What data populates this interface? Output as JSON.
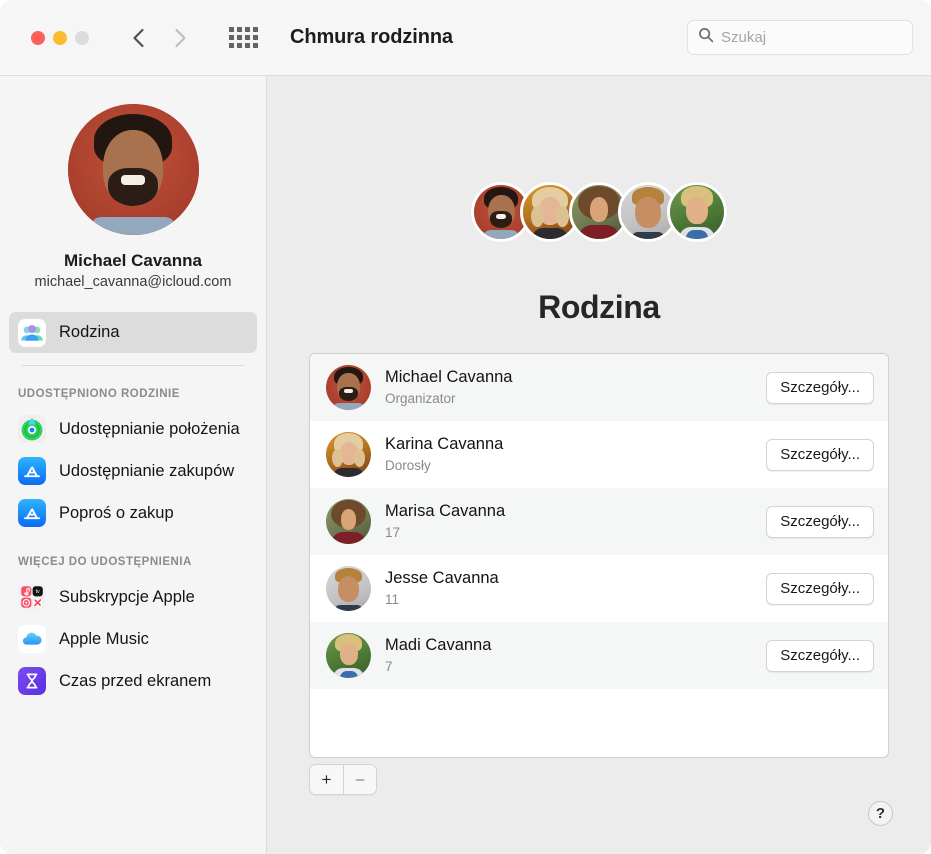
{
  "window": {
    "title": "Chmura rodzinna",
    "traffic_lights": [
      "close",
      "minimize",
      "zoom"
    ],
    "back_label": "Wstecz",
    "forward_label": "Dalej",
    "grid_label": "Pokaż wszystko"
  },
  "search": {
    "placeholder": "Szukaj",
    "value": "",
    "icon": "search-icon"
  },
  "sidebar": {
    "account": {
      "name": "Michael Cavanna",
      "email": "michael_cavanna@icloud.com",
      "avatar": "account-photo"
    },
    "primary": [
      {
        "label": "Rodzina",
        "icon": "family-group-icon",
        "selected": true
      }
    ],
    "sections": [
      {
        "heading": "UDOSTĘPNIONO RODZINIE",
        "items": [
          {
            "label": "Udostępnianie położenia",
            "icon": "find-my-icon"
          },
          {
            "label": "Udostępnianie zakupów",
            "icon": "app-store-icon"
          },
          {
            "label": "Poproś o zakup",
            "icon": "app-store-icon"
          }
        ]
      },
      {
        "heading": "WIĘCEJ DO UDOSTĘPNIENIA",
        "items": [
          {
            "label": "Subskrypcje Apple",
            "icon": "apple-services-icon"
          },
          {
            "label": "Apple Music",
            "icon": "icloud-icon"
          },
          {
            "label": "Czas przed ekranem",
            "icon": "screen-time-icon"
          }
        ]
      }
    ]
  },
  "main": {
    "title": "Rodzina",
    "avatar_stack": [
      "michael-avatar",
      "karina-avatar",
      "marisa-avatar",
      "jesse-avatar",
      "madi-avatar"
    ],
    "members": [
      {
        "name": "Michael Cavanna",
        "role": "Organizator",
        "button": "Szczegóły...",
        "avatar": "michael-avatar"
      },
      {
        "name": "Karina Cavanna",
        "role": "Dorosły",
        "button": "Szczegóły...",
        "avatar": "karina-avatar"
      },
      {
        "name": "Marisa Cavanna",
        "role": "17",
        "button": "Szczegóły...",
        "avatar": "marisa-avatar"
      },
      {
        "name": "Jesse Cavanna",
        "role": "11",
        "button": "Szczegóły...",
        "avatar": "jesse-avatar"
      },
      {
        "name": "Madi Cavanna",
        "role": "7",
        "button": "Szczegóły...",
        "avatar": "madi-avatar"
      }
    ],
    "add_button": "+",
    "remove_button": "–",
    "help_button": "?"
  },
  "colors": {
    "window_bg": "#ececec",
    "sidebar_bg": "#f5f5f5",
    "titlebar_bg": "#f6f6f6",
    "panel_bg": "#ffffff",
    "row_alt_bg": "#f5f6f6",
    "selection_bg": "#dcdcdc",
    "close_red": "#ff6158",
    "minimize_yellow": "#fcbb2f",
    "zoom_gray": "#dcdcdc",
    "secondary_text": "#8a8a8a"
  }
}
